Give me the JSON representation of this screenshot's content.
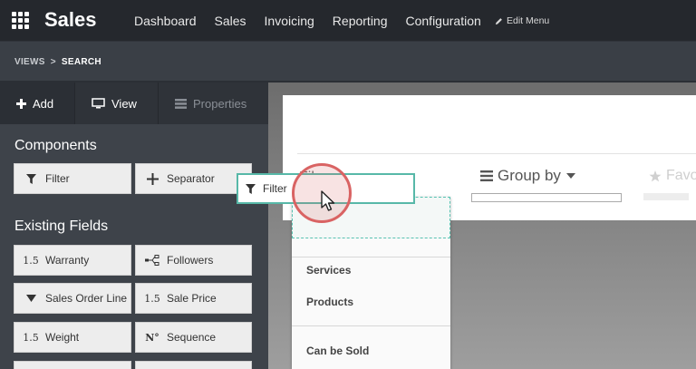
{
  "app": {
    "title": "Sales"
  },
  "nav": {
    "items": [
      "Dashboard",
      "Sales",
      "Invoicing",
      "Reporting",
      "Configuration"
    ],
    "edit_menu": "Edit Menu"
  },
  "breadcrumb": {
    "parent": "VIEWS",
    "separator": ">",
    "current": "SEARCH"
  },
  "sidebar": {
    "tabs": {
      "add": "Add",
      "view": "View",
      "properties": "Properties"
    },
    "components_title": "Components",
    "components": {
      "filter": "Filter",
      "separator": "Separator"
    },
    "existing_fields_title": "Existing Fields",
    "fields": [
      {
        "icon": "1.5",
        "label": "Warranty"
      },
      {
        "icon": "",
        "label": "Followers"
      },
      {
        "icon": "",
        "label": "Sales Order Line"
      },
      {
        "icon": "1.5",
        "label": "Sale Price"
      },
      {
        "icon": "1.5",
        "label": "Weight"
      },
      {
        "icon": "N°",
        "label": "Sequence"
      }
    ]
  },
  "canvas": {
    "filters_label": "Fil",
    "group_by": "Group by",
    "favorites": "Favo",
    "dropdown_items": {
      "services": "Services",
      "products": "Products",
      "can_be_sold": "Can be Sold"
    }
  },
  "dragging": {
    "label": "Filter"
  },
  "colors": {
    "accent": "#57b8a8",
    "click_ring": "#d96363"
  }
}
